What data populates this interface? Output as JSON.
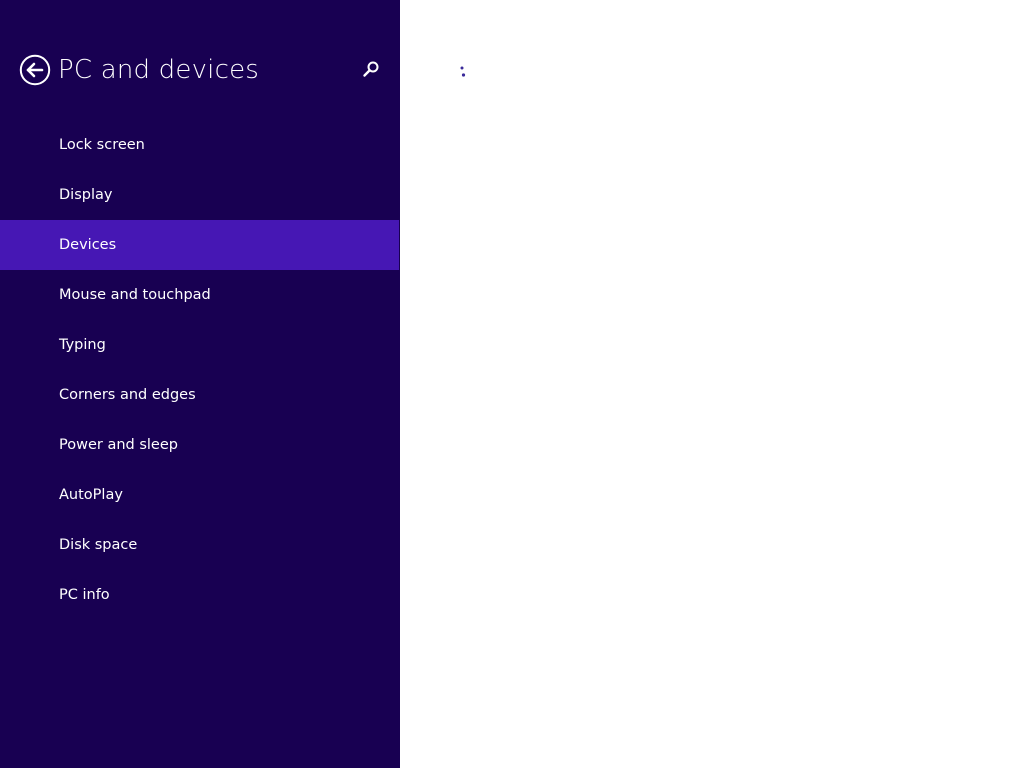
{
  "window": {
    "title": "PC and devices",
    "accent_color": "#4617b4",
    "sidebar_color": "#180052",
    "content_color": "#ffffff"
  },
  "header": {
    "back_icon": "back-arrow-circle-icon",
    "title": "PC and devices",
    "search_icon": "search-icon"
  },
  "sidebar": {
    "selected": "Devices",
    "items": [
      {
        "label": "Lock screen"
      },
      {
        "label": "Display"
      },
      {
        "label": "Devices"
      },
      {
        "label": "Mouse and touchpad"
      },
      {
        "label": "Typing"
      },
      {
        "label": "Corners and edges"
      },
      {
        "label": "Power and sleep"
      },
      {
        "label": "AutoPlay"
      },
      {
        "label": "Disk space"
      },
      {
        "label": "PC info"
      }
    ]
  },
  "content": {
    "state": "loading",
    "indicator_icon": "loading-dots-icon"
  }
}
